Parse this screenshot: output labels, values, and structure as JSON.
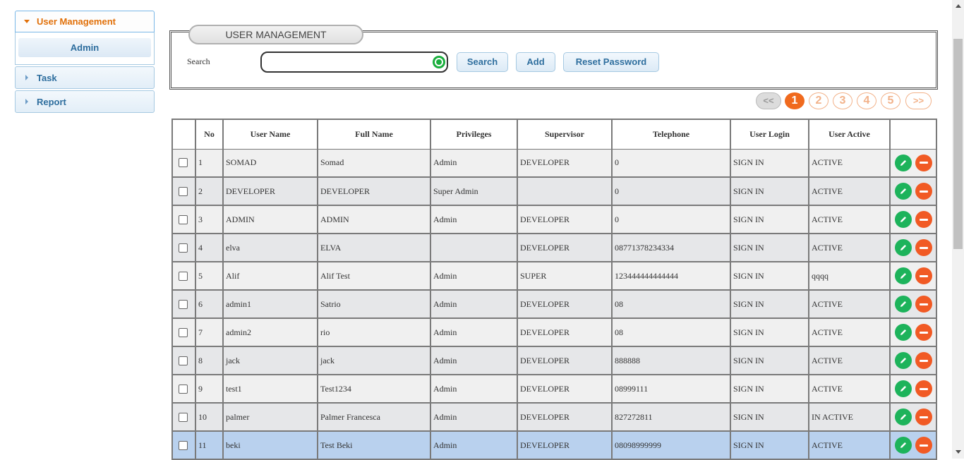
{
  "sidebar": {
    "sections": [
      {
        "label": "User Management",
        "items": [
          {
            "label": "Admin"
          }
        ]
      },
      {
        "label": "Task"
      },
      {
        "label": "Report"
      }
    ]
  },
  "panel": {
    "legend": "USER MANAGEMENT",
    "search_label": "Search",
    "search_value": "",
    "buttons": {
      "search": "Search",
      "add": "Add",
      "reset_password": "Reset Password"
    }
  },
  "pagination": {
    "prev": "<<",
    "pages": [
      "1",
      "2",
      "3",
      "4",
      "5"
    ],
    "current": "1",
    "next": ">>"
  },
  "table": {
    "headers": [
      "",
      "No",
      "User Name",
      "Full Name",
      "Privileges",
      "Supervisor",
      "Telephone",
      "User Login",
      "User Active",
      ""
    ],
    "rows": [
      {
        "no": "1",
        "username": "SOMAD",
        "fullname": "Somad",
        "privileges": "Admin",
        "supervisor": "DEVELOPER",
        "telephone": "0",
        "login": "SIGN IN",
        "active": "ACTIVE"
      },
      {
        "no": "2",
        "username": "DEVELOPER",
        "fullname": "DEVELOPER",
        "privileges": "Super Admin",
        "supervisor": "",
        "telephone": "0",
        "login": "SIGN IN",
        "active": "ACTIVE"
      },
      {
        "no": "3",
        "username": "ADMIN",
        "fullname": "ADMIN",
        "privileges": "Admin",
        "supervisor": "DEVELOPER",
        "telephone": "0",
        "login": "SIGN IN",
        "active": "ACTIVE"
      },
      {
        "no": "4",
        "username": "elva",
        "fullname": "ELVA",
        "privileges": "",
        "supervisor": "DEVELOPER",
        "telephone": "08771378234334",
        "login": "SIGN IN",
        "active": "ACTIVE"
      },
      {
        "no": "5",
        "username": "Alif",
        "fullname": "Alif Test",
        "privileges": "Admin",
        "supervisor": "SUPER",
        "telephone": "123444444444444",
        "login": "SIGN IN",
        "active": "qqqq"
      },
      {
        "no": "6",
        "username": "admin1",
        "fullname": "Satrio",
        "privileges": "Admin",
        "supervisor": "DEVELOPER",
        "telephone": "08",
        "login": "SIGN IN",
        "active": "ACTIVE"
      },
      {
        "no": "7",
        "username": "admin2",
        "fullname": "rio",
        "privileges": "Admin",
        "supervisor": "DEVELOPER",
        "telephone": "08",
        "login": "SIGN IN",
        "active": "ACTIVE"
      },
      {
        "no": "8",
        "username": "jack",
        "fullname": "jack",
        "privileges": "Admin",
        "supervisor": "DEVELOPER",
        "telephone": "888888",
        "login": "SIGN IN",
        "active": "ACTIVE"
      },
      {
        "no": "9",
        "username": "test1",
        "fullname": "Test1234",
        "privileges": "Admin",
        "supervisor": "DEVELOPER",
        "telephone": "08999111",
        "login": "SIGN IN",
        "active": "ACTIVE"
      },
      {
        "no": "10",
        "username": "palmer",
        "fullname": "Palmer Francesca",
        "privileges": "Admin",
        "supervisor": "DEVELOPER",
        "telephone": "827272811",
        "login": "SIGN IN",
        "active": "IN ACTIVE"
      },
      {
        "no": "11",
        "username": "beki",
        "fullname": "Test Beki",
        "privileges": "Admin",
        "supervisor": "DEVELOPER",
        "telephone": "08098999999",
        "login": "SIGN IN",
        "active": "ACTIVE"
      }
    ],
    "selected_row": "11"
  },
  "colors": {
    "accent": "#e17009",
    "link": "#2e6e9e",
    "edit": "#1db35b",
    "delete": "#f15a24",
    "selected_row": "#b9d1ee"
  },
  "icons": {
    "edit": "pencil-icon",
    "delete": "minus-icon",
    "clear": "clear-search-icon"
  }
}
